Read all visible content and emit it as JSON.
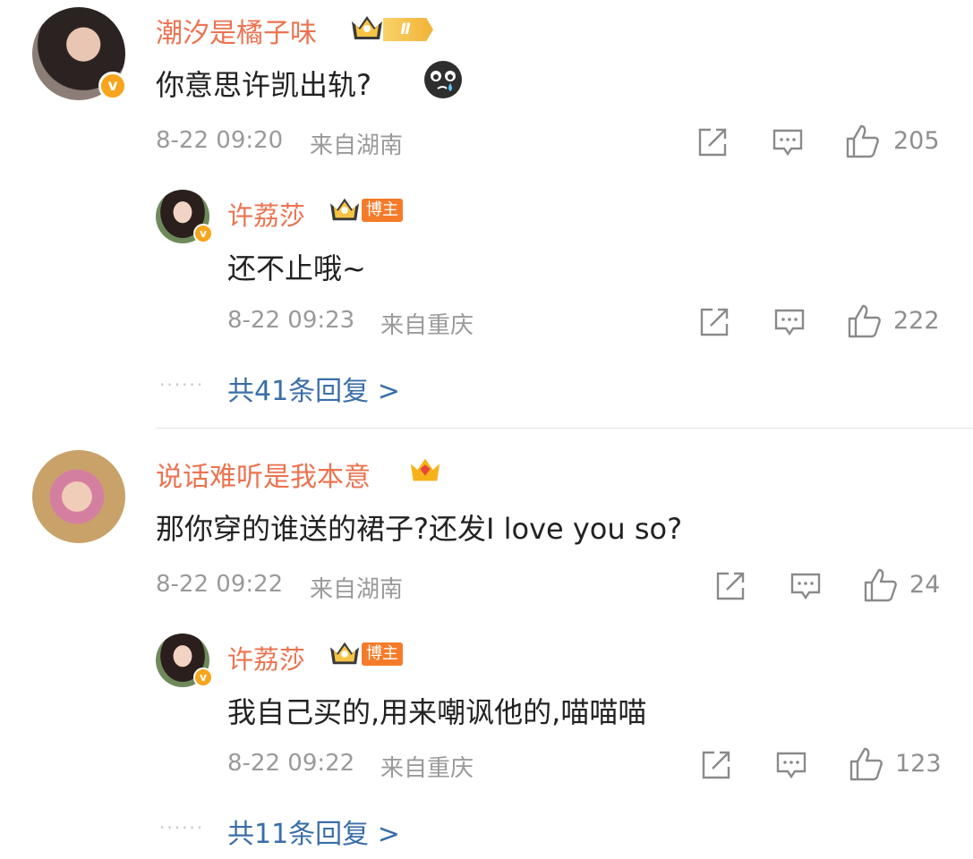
{
  "comments": [
    {
      "username": "潮汐是橘子味",
      "level_badge": "Ⅱ",
      "text": "你意思许凯出轨?",
      "emoji": "crying-face-icon",
      "time": "8-22 09:20",
      "location": "来自湖南",
      "likes": "205",
      "reply": {
        "username": "许荔莎",
        "tag": "博主",
        "text": "还不止哦~",
        "time": "8-22 09:23",
        "location": "来自重庆",
        "likes": "222"
      },
      "more_replies": "共41条回复 >"
    },
    {
      "username": "说话难听是我本意",
      "text": "那你穿的谁送的裙子?还发I love you so?",
      "time": "8-22 09:22",
      "location": "来自湖南",
      "likes": "24",
      "reply": {
        "username": "许荔莎",
        "tag": "博主",
        "text": "我自己买的,用来嘲讽他的,喵喵喵",
        "time": "8-22 09:22",
        "location": "来自重庆",
        "likes": "123"
      },
      "more_replies": "共11条回复 >"
    }
  ],
  "verified_badge": "v",
  "dots": "······",
  "colors": {
    "username": "#eb7350",
    "link": "#3a6ea8",
    "meta": "#9a9a9a",
    "badge": "#f57b2a"
  }
}
